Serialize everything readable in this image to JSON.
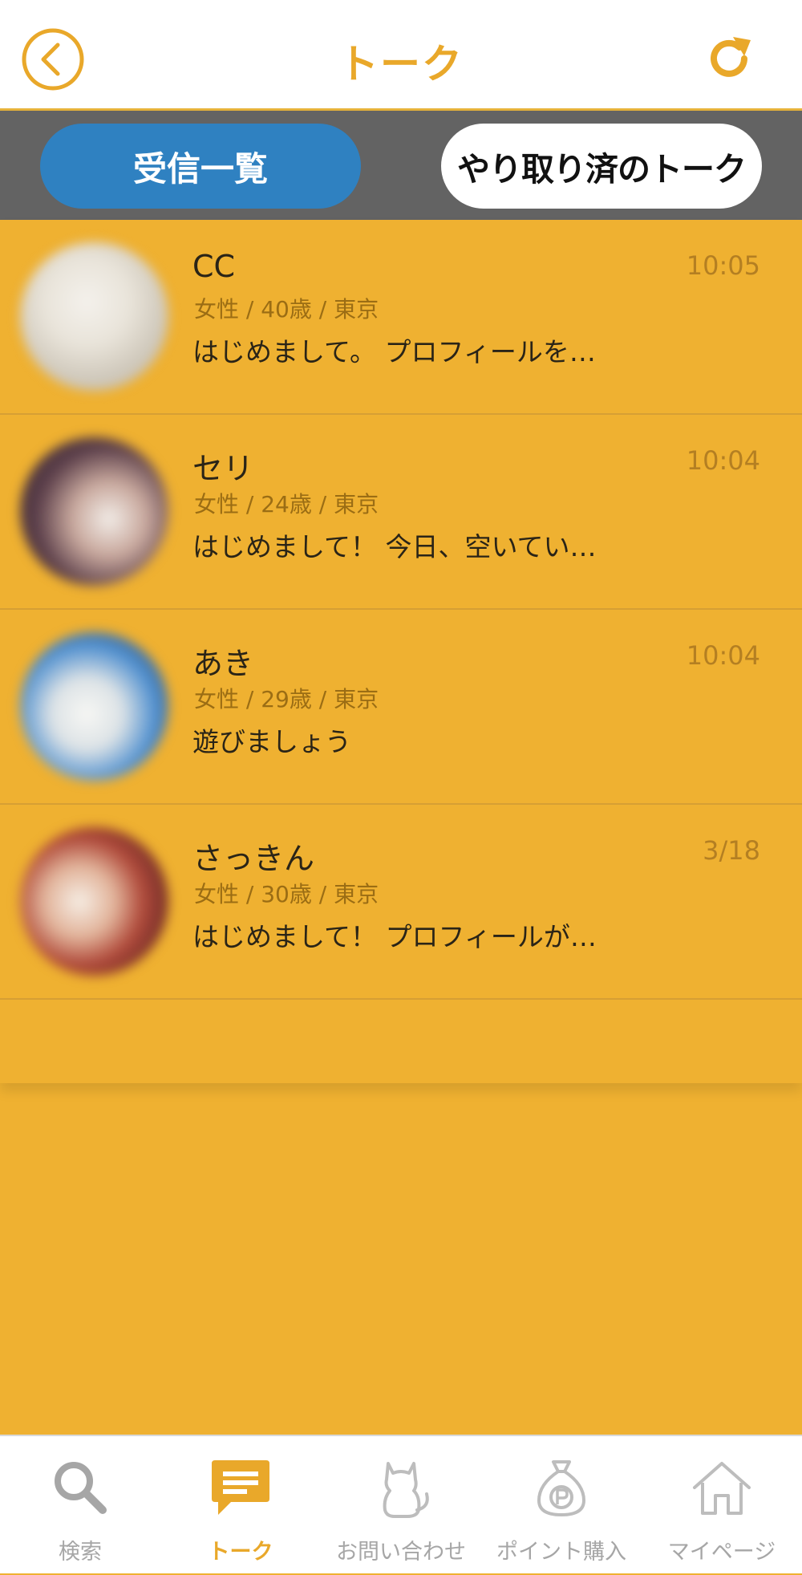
{
  "header": {
    "title": "トーク",
    "back_icon": "chevron-left-circle-icon",
    "refresh_icon": "refresh-icon"
  },
  "tabs": [
    {
      "label": "受信一覧",
      "active": true,
      "color": "#2f81c1"
    },
    {
      "label": "やり取り済のトーク",
      "active": false
    }
  ],
  "conversations": [
    {
      "name": "CC",
      "meta": "女性 / 40歳 / 東京",
      "message": "はじめまして。 プロフィールを…",
      "time": "10:05"
    },
    {
      "name": "セリ",
      "meta": "女性 / 24歳 / 東京",
      "message": "はじめまして！ 今日、空いてい…",
      "time": "10:04"
    },
    {
      "name": "あき",
      "meta": "女性 / 29歳 / 東京",
      "message": "遊びましょう",
      "time": "10:04"
    },
    {
      "name": "さっきん",
      "meta": "女性 / 30歳 / 東京",
      "message": "はじめまして！ プロフィールが…",
      "time": "3/18"
    }
  ],
  "bottom_nav": [
    {
      "label": "検索",
      "icon": "search-icon",
      "active": false
    },
    {
      "label": "トーク",
      "icon": "chat-icon",
      "active": true
    },
    {
      "label": "お問い合わせ",
      "icon": "cat-icon",
      "active": false
    },
    {
      "label": "ポイント購入",
      "icon": "points-bag-icon",
      "active": false
    },
    {
      "label": "マイページ",
      "icon": "home-icon",
      "active": false
    }
  ],
  "colors": {
    "accent": "#e9a82a",
    "list_background": "#efb131",
    "tab_bar": "#636363"
  }
}
